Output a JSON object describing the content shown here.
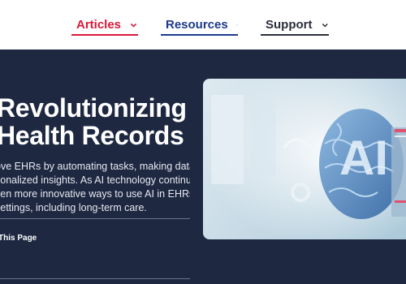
{
  "nav": {
    "items": [
      {
        "label": "Articles"
      },
      {
        "label": "Resources"
      },
      {
        "label": "Support"
      }
    ]
  },
  "hero": {
    "title_line1": "Revolutionizing",
    "title_line2": "Health Records",
    "description_lines": [
      "ove EHRs by automating tasks, making data",
      "sonalized insights. As AI technology continues",
      "ven more innovative ways to use AI in EHRs to",
      "settings, including long-term care."
    ],
    "share_label": "This Page"
  },
  "image": {
    "ai_text": "AI",
    "colors": {
      "brain": "#5b90c8",
      "chip": "#c8d8e6",
      "accent": "#e05070"
    }
  },
  "colors": {
    "hero_bg": "#1e2841",
    "articles": "#d7193a",
    "resources": "#1d3a8a",
    "support": "#2b2f3a"
  }
}
